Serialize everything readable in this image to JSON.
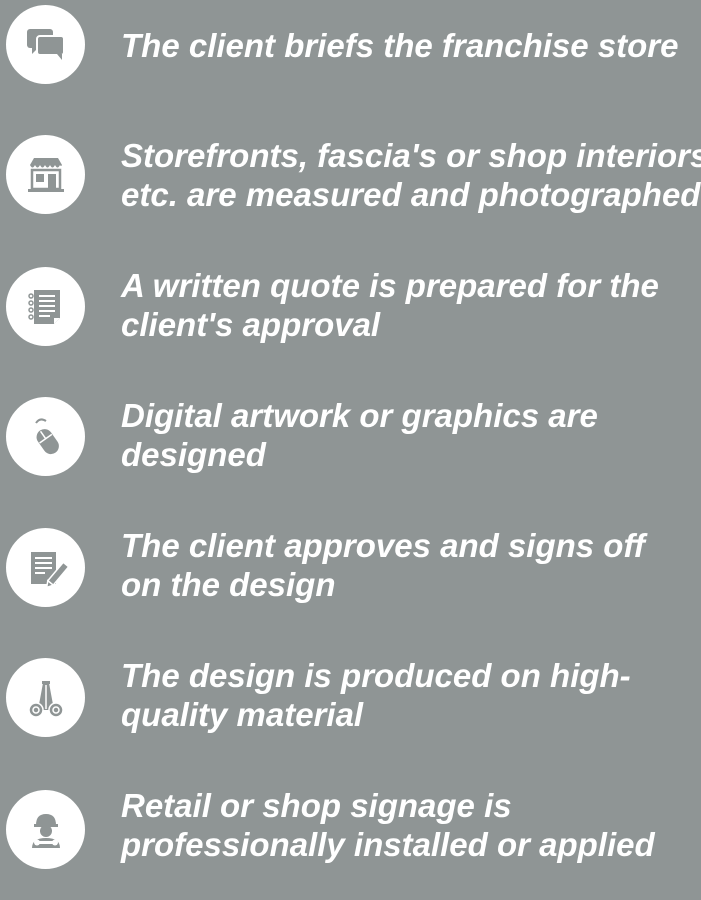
{
  "colors": {
    "background": "#8f9595",
    "circle": "#ffffff",
    "icon": "#8f9595",
    "text": "#ffffff"
  },
  "steps": [
    {
      "icon": "chat-bubbles-icon",
      "lines": [
        "The client briefs the franchise store"
      ]
    },
    {
      "icon": "storefront-icon",
      "lines": [
        "Storefronts, fascia's or shop interiors",
        "etc. are measured and photographed"
      ]
    },
    {
      "icon": "document-list-icon",
      "lines": [
        "A written quote is prepared for the",
        "client's approval"
      ]
    },
    {
      "icon": "computer-mouse-icon",
      "lines": [
        "Digital artwork or graphics are",
        "designed"
      ]
    },
    {
      "icon": "sign-document-icon",
      "lines": [
        "The client approves and signs off",
        "on the design"
      ]
    },
    {
      "icon": "material-rolls-icon",
      "lines": [
        "The design is produced on high-",
        "quality material"
      ]
    },
    {
      "icon": "installer-worker-icon",
      "lines": [
        "Retail or shop signage is",
        "professionally installed or applied"
      ]
    }
  ]
}
